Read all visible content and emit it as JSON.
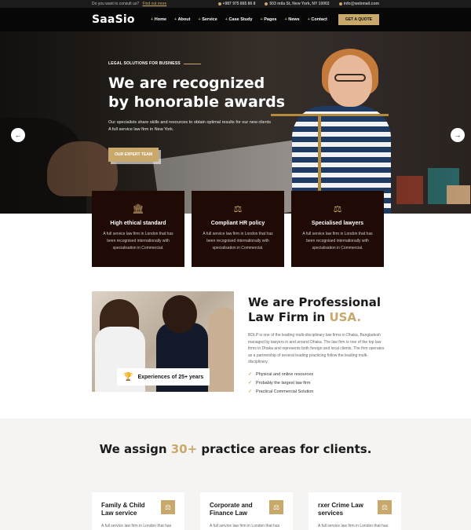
{
  "topbar": {
    "consult_text": "Do you want to consult us?",
    "consult_link": "Find out more",
    "phone": "+987 975 865 86 8",
    "address": "503 mila St, New York, NY 10002",
    "email": "info@webmail.com"
  },
  "nav": {
    "logo": "SaaSio",
    "items": [
      "Home",
      "About",
      "Service",
      "Case Study",
      "Pages",
      "News",
      "Contact"
    ],
    "cta": "GET A QUOTE"
  },
  "hero": {
    "kicker": "LEGAL SOLUTIONS FOR BUSINESS",
    "title": "We are recognized by honorable awards",
    "description": "Our specialists share skills and resources to obtain optimal results for our new clients A full service law firm in New York.",
    "button": "OUR EXPERT TEAM",
    "prev_arrow": "←",
    "next_arrow": "→"
  },
  "features": [
    {
      "icon": "institution-icon",
      "glyph": "🏛",
      "title": "High ethical standard",
      "text": "A full service law firm in London that has been recognised internationally with specialisation in Commercial."
    },
    {
      "icon": "gavel-icon",
      "glyph": "⚖",
      "title": "Compliant HR policy",
      "text": "A full service law firm in London that has been recognised internationally with specialisation in Commercial."
    },
    {
      "icon": "scales-icon",
      "glyph": "⚖",
      "title": "Specialised lawyers",
      "text": "A full service law firm in London that has been recognised internationally with specialisation in Commercial."
    }
  ],
  "about": {
    "title_part1": "We are Professional Law Firm in ",
    "title_highlight": "USA.",
    "description": "BDLP is one of the leading multi-disciplinary law firms in Dhaka, Bangladesh managed by lawyers in and around Dhaka. The law firm is one of the top law firms in Dhaka and represents both foreign and local clients. The firm operates as a partnership of several leading practicing follow the leading multi-disciplinary.",
    "list": [
      "Physical and online resources",
      "Probably the largest law firm",
      "Practical Commercial Solution"
    ],
    "badge": "Experiences of 25+ years"
  },
  "practice": {
    "title_part1": "We assign ",
    "title_highlight": "30+",
    "title_part2": " practice areas for clients.",
    "cards": [
      {
        "title": "Family & Child Law service",
        "text": "A full service law firm in London that has"
      },
      {
        "title": "Corporate and Finance Law",
        "text": "A full service law firm in London that has"
      },
      {
        "title": "rxer Crime Law services",
        "text": "A full service law firm in London that has"
      }
    ]
  },
  "colors": {
    "accent": "#c9a86b",
    "dark": "#1f0a06",
    "nav": "#070707"
  }
}
